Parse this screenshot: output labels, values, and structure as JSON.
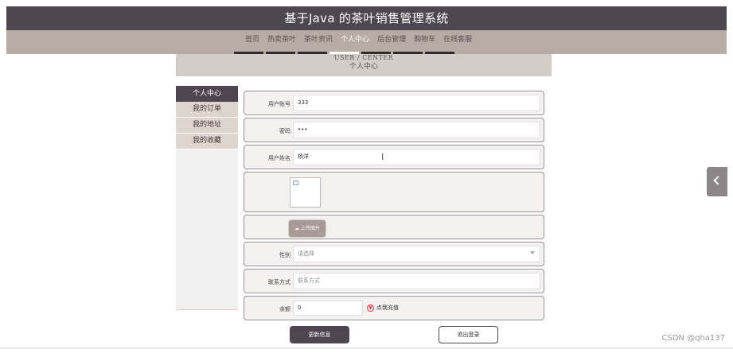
{
  "header": {
    "title": "基于Java 的茶叶销售管理系统"
  },
  "nav": {
    "items": [
      {
        "label": "首页",
        "active": false
      },
      {
        "label": "热卖茶叶",
        "active": false
      },
      {
        "label": "茶叶资讯",
        "active": false
      },
      {
        "label": "个人中心",
        "active": true
      },
      {
        "label": "后台管理",
        "active": false
      },
      {
        "label": "购物车",
        "active": false
      },
      {
        "label": "在线客服",
        "active": false
      }
    ]
  },
  "banner": {
    "en": "USER / CENTER",
    "zh": "个人中心"
  },
  "sidebar": {
    "items": [
      {
        "label": "个人中心",
        "active": true
      },
      {
        "label": "我的订单",
        "active": false
      },
      {
        "label": "我的地址",
        "active": false
      },
      {
        "label": "我的收藏",
        "active": false
      }
    ]
  },
  "form": {
    "account_label": "用户账号",
    "account_value": "333",
    "password_label": "密码",
    "password_value": "•••",
    "name_label": "用户姓名",
    "name_value": "杨洋",
    "upload_label": "上传图片",
    "gender_label": "性别",
    "gender_placeholder": "请选择",
    "contact_label": "联系方式",
    "contact_placeholder": "联系方式",
    "balance_label": "余额",
    "balance_value": "0",
    "recharge_label": "点我充值"
  },
  "buttons": {
    "update": "更新信息",
    "logout": "退出登录"
  },
  "watermark": "CSDN @qha137",
  "colors": {
    "primary": "#4e4650",
    "nav_bg": "#b7aba6",
    "banner_bg": "#d4ccc7",
    "side_bg": "#ded5cf"
  }
}
